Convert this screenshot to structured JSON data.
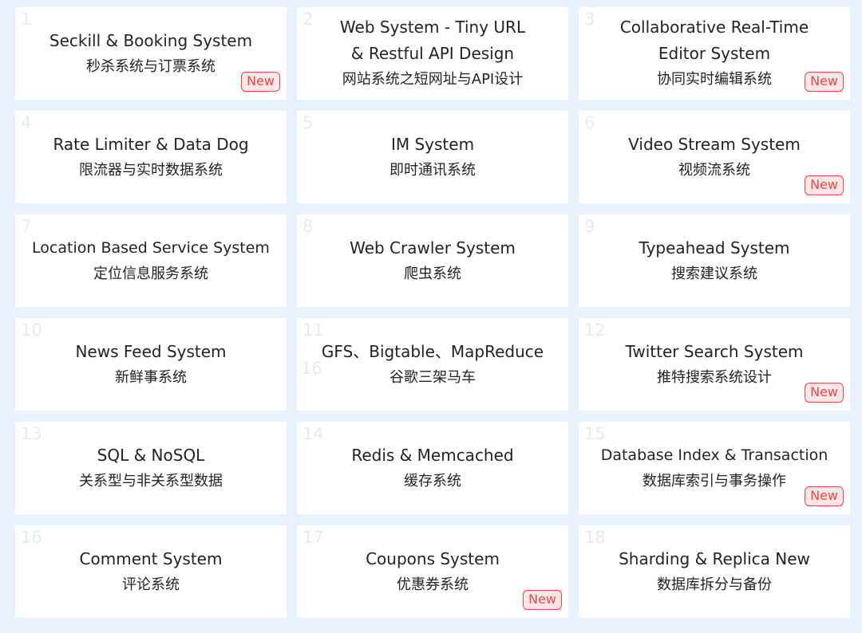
{
  "cards": [
    {
      "num": "1",
      "en": "Seckill & Booking System",
      "zh": "秒杀系统与订票系统",
      "badge": "New"
    },
    {
      "num": "2",
      "en": "Web System - Tiny URL & Restful API Design",
      "zh": "网站系统之短网址与API设计",
      "badge": ""
    },
    {
      "num": "3",
      "en": "Collaborative Real-Time Editor System",
      "zh": "协同实时编辑系统",
      "badge": "New"
    },
    {
      "num": "4",
      "en": "Rate Limiter & Data Dog",
      "zh": "限流器与实时数据系统",
      "badge": ""
    },
    {
      "num": "5",
      "en": "IM System",
      "zh": "即时通讯系统",
      "badge": ""
    },
    {
      "num": "6",
      "en": "Video Stream System",
      "zh": "视频流系统",
      "badge": "New"
    },
    {
      "num": "7",
      "en": "Location Based Service System",
      "zh": "定位信息服务系统",
      "badge": ""
    },
    {
      "num": "8",
      "en": "Web Crawler System",
      "zh": "爬虫系统",
      "badge": ""
    },
    {
      "num": "9",
      "en": "Typeahead System",
      "zh": "搜索建议系统",
      "badge": ""
    },
    {
      "num": "10",
      "en": "News Feed System",
      "zh": "新鲜事系统",
      "badge": ""
    },
    {
      "num": "11",
      "num2": "16",
      "en": "GFS、Bigtable、MapReduce",
      "zh": "谷歌三架马车",
      "badge": ""
    },
    {
      "num": "12",
      "en": "Twitter Search System",
      "zh": "推特搜索系统设计",
      "badge": "New"
    },
    {
      "num": "13",
      "en": "SQL & NoSQL",
      "zh": "关系型与非关系型数据",
      "badge": ""
    },
    {
      "num": "14",
      "en": "Redis & Memcached",
      "zh": "缓存系统",
      "badge": ""
    },
    {
      "num": "15",
      "en": "Database Index & Transaction",
      "zh": "数据库索引与事务操作",
      "badge": "New"
    },
    {
      "num": "16",
      "en": "Comment System",
      "zh": "评论系统",
      "badge": ""
    },
    {
      "num": "17",
      "en": "Coupons System",
      "zh": "优惠券系统",
      "badge": "New"
    },
    {
      "num": "18",
      "en": "Sharding & Replica New",
      "zh": "数据库拆分与备份",
      "badge": ""
    }
  ],
  "colors": {
    "background": "#e9f1fd",
    "card": "#ffffff",
    "badge_border": "#e04a4a",
    "badge_fill": "#ffe6e6",
    "number": "#e5ebf6"
  }
}
